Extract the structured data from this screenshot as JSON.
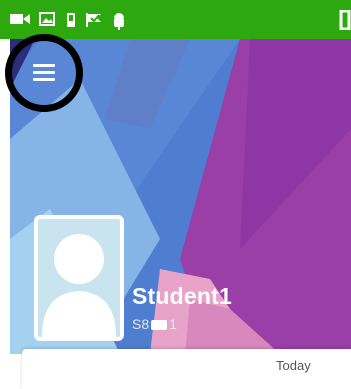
{
  "status_bar": {
    "color": "#2ea80f",
    "icons": [
      "video-camera-icon",
      "image-icon",
      "phone-icon",
      "check-flag-icon",
      "android-icon",
      "battery-icon"
    ]
  },
  "header": {
    "menu_icon": "hamburger-menu-icon"
  },
  "profile": {
    "name": "Student1",
    "id": "S8",
    "id_trailing": "1",
    "avatar_icon": "person-silhouette-icon"
  },
  "card": {
    "date_label": "Today"
  }
}
